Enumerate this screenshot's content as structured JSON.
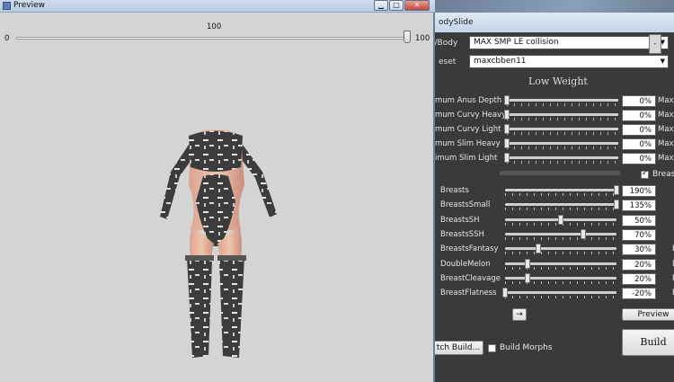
{
  "preview_window": {
    "title": "Preview",
    "window_buttons": {
      "minimize": "▁",
      "maximize": "□",
      "close": "✕"
    },
    "slider": {
      "value_label": "100",
      "min_label": "0",
      "max_label": "100",
      "level": 1.0
    }
  },
  "bodyslide": {
    "title": "odySlide",
    "outfit_label": "t/Body",
    "outfit_value": "MAX SMP LE collision",
    "preset_label": "eset",
    "preset_value": "maxcbben11",
    "right_btn": "-",
    "low_weight_title": "Low Weight",
    "top_sliders": [
      {
        "name": "mum Anus Depth",
        "value": "0%",
        "max": "Maxi",
        "level": 0.0
      },
      {
        "name": "mum Curvy Heavy",
        "value": "0%",
        "max": "Maxi",
        "level": 0.0
      },
      {
        "name": "mum Curvy Light",
        "value": "0%",
        "max": "Maxi",
        "level": 0.0
      },
      {
        "name": "mum Slim Heavy",
        "value": "0%",
        "max": "Maxi",
        "level": 0.0
      },
      {
        "name": "imum Slim Light",
        "value": "0%",
        "max": "Max",
        "level": 0.0
      }
    ],
    "breasts_checkbox_label": "Breas",
    "breast_sliders": [
      {
        "name": "Breasts",
        "value": "190%",
        "max": "",
        "level": 1.0
      },
      {
        "name": "BreastsSmall",
        "value": "135%",
        "max": "",
        "level": 1.0
      },
      {
        "name": "BreastsSH",
        "value": "50%",
        "max": "",
        "level": 0.5
      },
      {
        "name": "BreastsSSH",
        "value": "70%",
        "max": "",
        "level": 0.7
      },
      {
        "name": "BreastsFantasy",
        "value": "30%",
        "max": "B",
        "level": 0.3
      },
      {
        "name": "DoubleMelon",
        "value": "20%",
        "max": "D",
        "level": 0.2
      },
      {
        "name": "BreastCleavage",
        "value": "20%",
        "max": "B",
        "level": 0.2
      },
      {
        "name": "BreastFlatness",
        "value": "-20%",
        "max": "B",
        "level": 0.0
      }
    ],
    "arrow_button": "→",
    "preview_button": "Preview",
    "batch_build_button": "tch Build...",
    "build_morphs_label": "Build Morphs",
    "build_button": "Build"
  }
}
